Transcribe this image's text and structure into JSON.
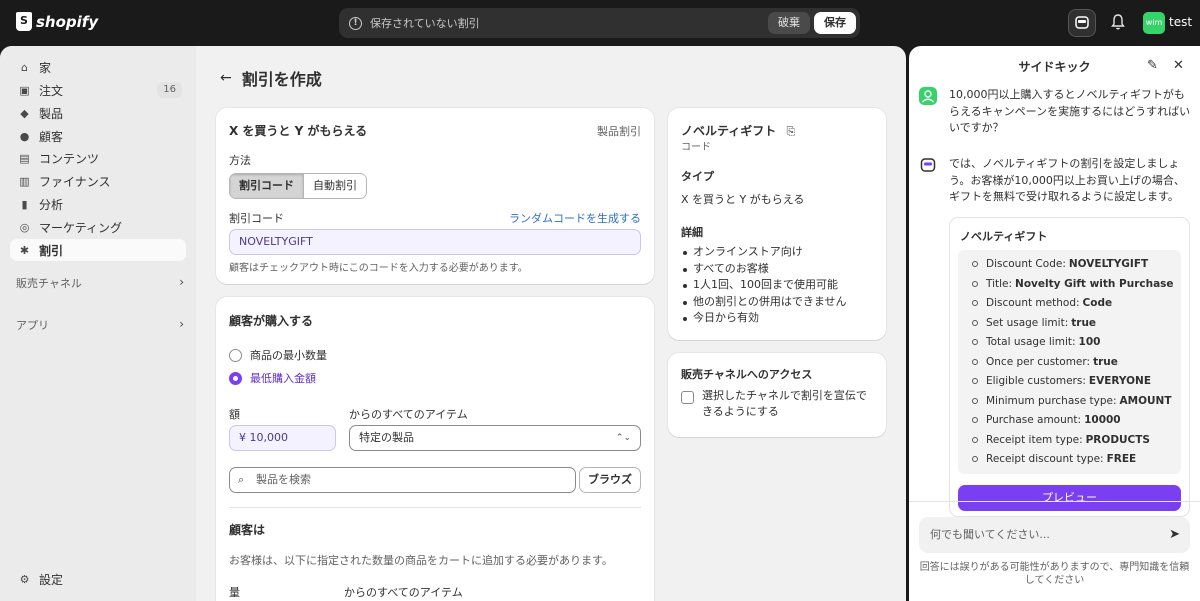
{
  "topbar": {
    "logo_text": "shopify",
    "unsaved_message": "保存されていない割引",
    "discard_label": "破棄",
    "save_label": "保存",
    "avatar_initials": "wim",
    "store_name": "test"
  },
  "sidebar": {
    "items": [
      {
        "icon": "home-icon",
        "glyph": "⌂",
        "label": "家"
      },
      {
        "icon": "orders-icon",
        "glyph": "▣",
        "label": "注文",
        "badge": "16"
      },
      {
        "icon": "products-icon",
        "glyph": "◆",
        "label": "製品"
      },
      {
        "icon": "customers-icon",
        "glyph": "●",
        "label": "顧客"
      },
      {
        "icon": "content-icon",
        "glyph": "▤",
        "label": "コンテンツ"
      },
      {
        "icon": "finance-icon",
        "glyph": "▥",
        "label": "ファイナンス"
      },
      {
        "icon": "analytics-icon",
        "glyph": "▮",
        "label": "分析"
      },
      {
        "icon": "marketing-icon",
        "glyph": "◎",
        "label": "マーケティング"
      },
      {
        "icon": "discounts-icon",
        "glyph": "✱",
        "label": "割引"
      }
    ],
    "sales_channels": "販売チャネル",
    "apps": "アプリ",
    "settings": "設定"
  },
  "page": {
    "title": "割引を作成"
  },
  "discount_card": {
    "title": "X を買うと Y がもらえる",
    "type_label": "製品割引",
    "method_label": "方法",
    "method_code": "割引コード",
    "method_auto": "自動割引",
    "code_label": "割引コード",
    "generate_link": "ランダムコードを生成する",
    "code_value": "NOVELTYGIFT",
    "code_help": "顧客はチェックアウト時にこのコードを入力する必要があります。"
  },
  "buys_card": {
    "title": "顧客が購入する",
    "option_min_qty": "商品の最小数量",
    "option_min_amount": "最低購入金額",
    "amount_label": "額",
    "amount_value": "¥  10,000",
    "items_label": "からのすべてのアイテム",
    "items_select": "特定の製品",
    "search_placeholder": "製品を検索",
    "browse_label": "ブラウズ",
    "gets_title": "顧客は",
    "gets_desc": "お客様は、以下に指定された数量の商品をカートに追加する必要があります。",
    "qty_label": "量",
    "gets_items_label": "からのすべてのアイテム"
  },
  "summary_card": {
    "title": "ノベルティギフト",
    "subtitle": "コード",
    "type_heading": "タイプ",
    "type_value": "X を買うと Y がもらえる",
    "details_heading": "詳細",
    "details": [
      "オンラインストア向け",
      "すべてのお客様",
      "1人1回、100回まで使用可能",
      "他の割引との併用はできません",
      "今日から有効"
    ]
  },
  "channel_card": {
    "title": "販売チャネルへのアクセス",
    "checkbox_label": "選択したチャネルで割引を宣伝できるようにする"
  },
  "sidekick": {
    "title": "サイドキック",
    "user_message": "10,000円以上購入するとノベルティギフトがもらえるキャンペーンを実施するにはどうすればいいですか？",
    "assistant_message": "では、ノベルティギフトの割引を設定しましょう。お客様が10,000円以上お買い上げの場合、ギフトを無料で受け取れるように設定します。",
    "card_title": "ノベルティギフト",
    "fields": [
      {
        "key": "Discount Code:",
        "value": "NOVELTYGIFT"
      },
      {
        "key": "Title:",
        "value": "Novelty Gift with Purchase"
      },
      {
        "key": "Discount method:",
        "value": "Code"
      },
      {
        "key": "Set usage limit:",
        "value": "true"
      },
      {
        "key": "Total usage limit:",
        "value": "100"
      },
      {
        "key": "Once per customer:",
        "value": "true"
      },
      {
        "key": "Eligible customers:",
        "value": "EVERYONE"
      },
      {
        "key": "Minimum purchase type:",
        "value": "AMOUNT"
      },
      {
        "key": "Purchase amount:",
        "value": "10000"
      },
      {
        "key": "Receipt item type:",
        "value": "PRODUCTS"
      },
      {
        "key": "Receipt discount type:",
        "value": "FREE"
      }
    ],
    "preview_label": "プレビュー",
    "input_placeholder": "何でも聞いてください...",
    "footer": "回答には誤りがある可能性がありますので、専門知識を信頼してください"
  },
  "colors": {
    "accent": "#7b3ff2",
    "link": "#2c6ecb",
    "topbar": "#1a1a1a"
  }
}
